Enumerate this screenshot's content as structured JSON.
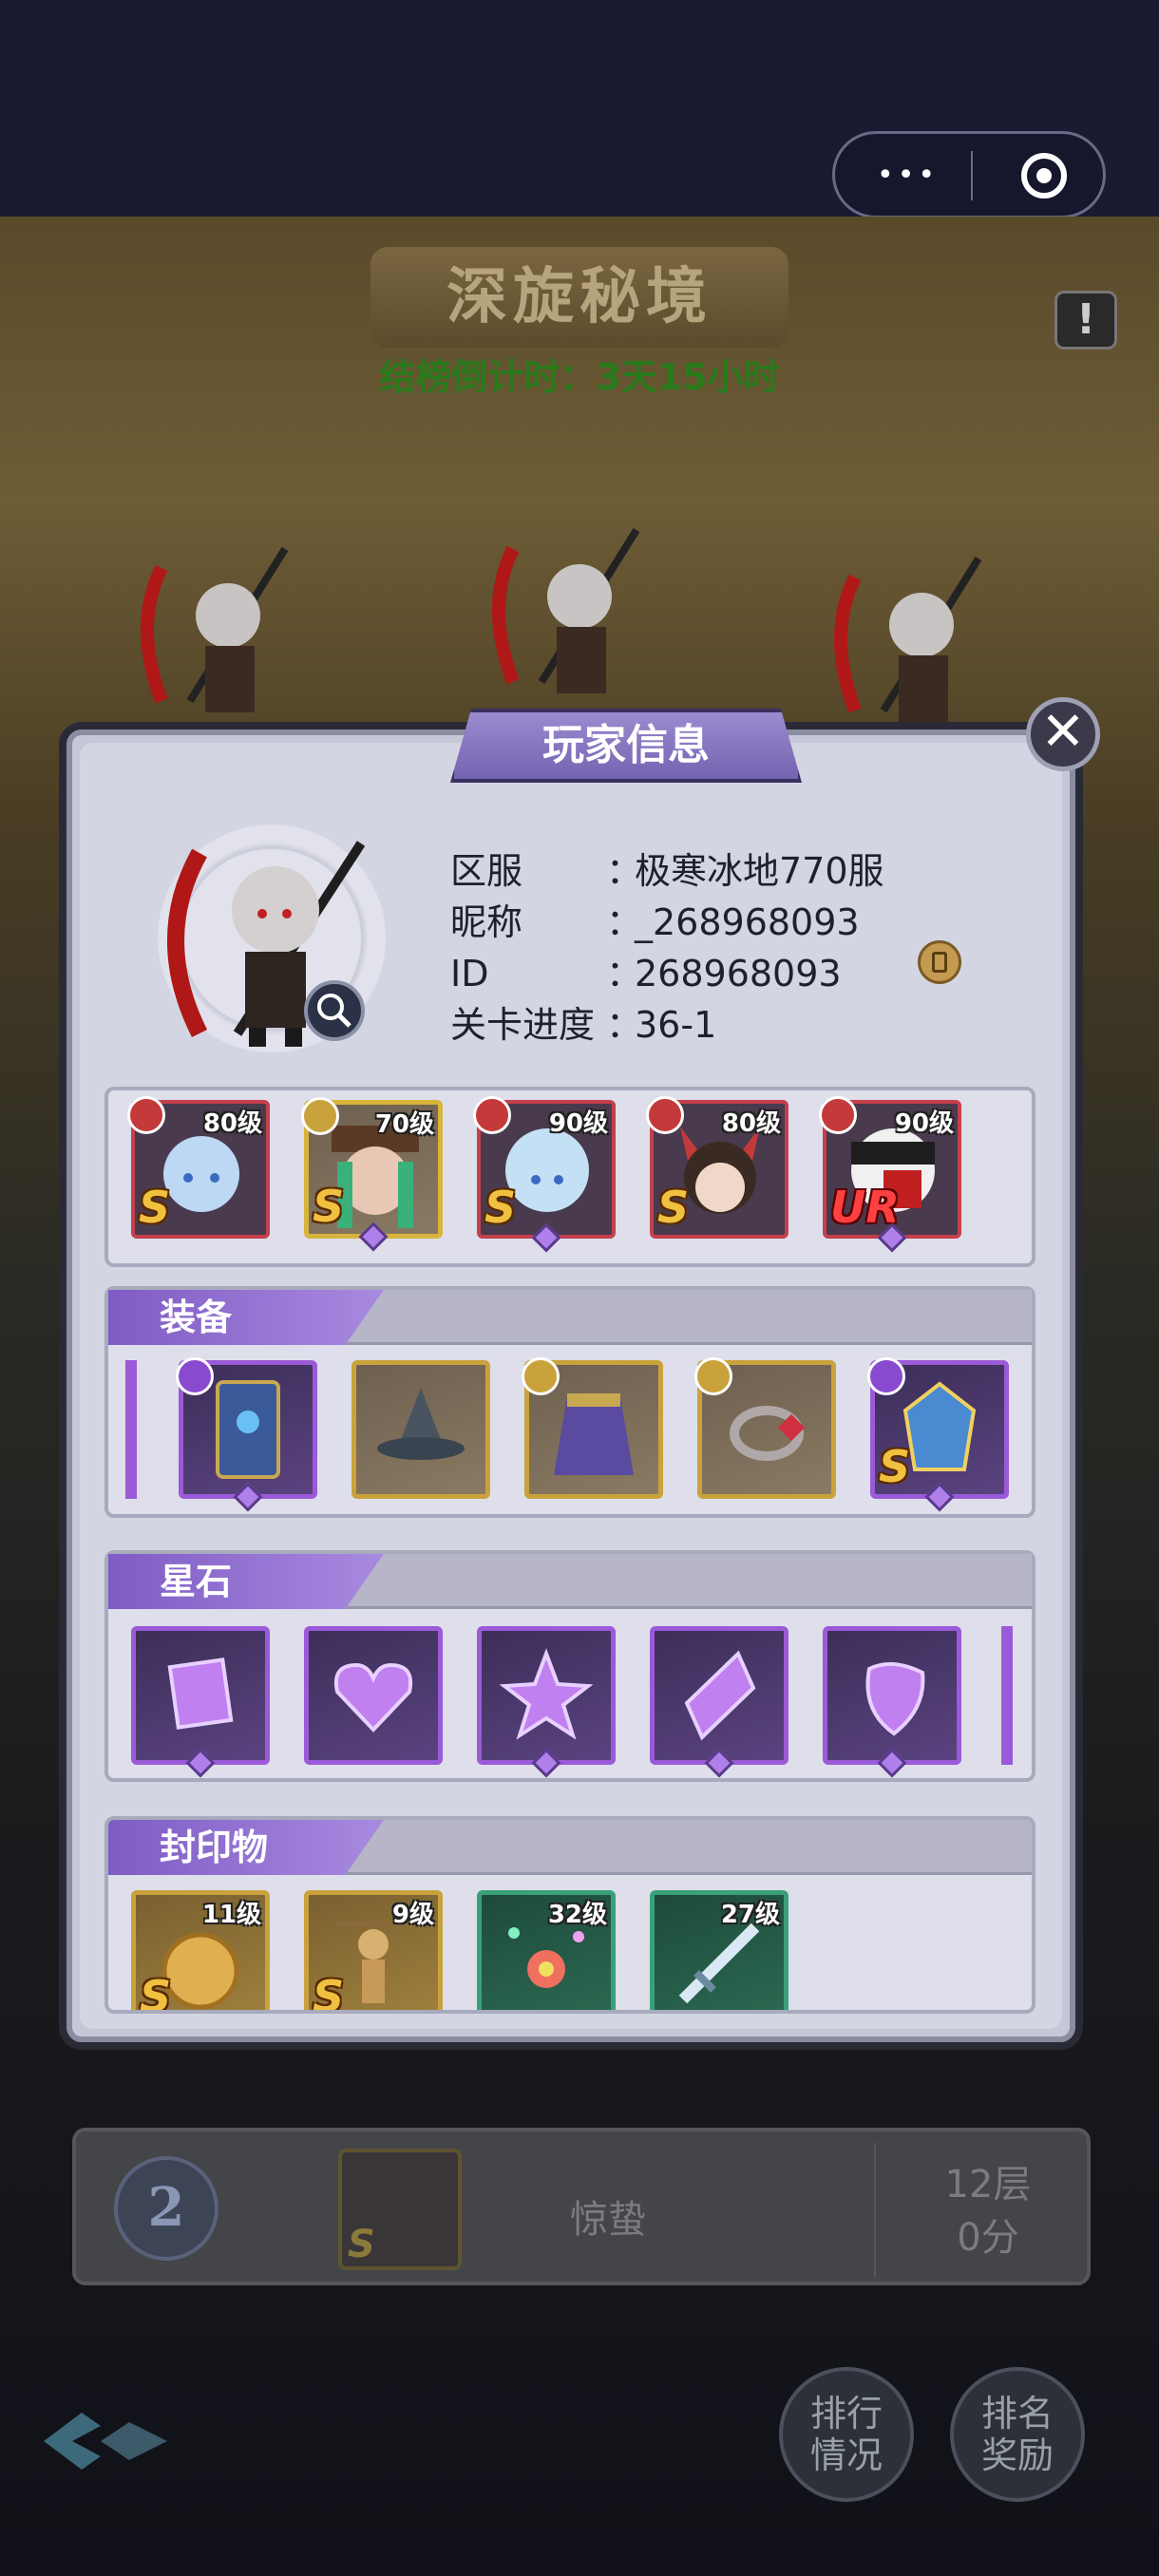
{
  "scene": {
    "title": "深旋秘境",
    "countdown": "结榜倒计时：3天15小时",
    "alert_glyph": "!"
  },
  "modal": {
    "title": "玩家信息",
    "close_glyph": "✕",
    "info": [
      {
        "label": "区服",
        "colon": "：",
        "value": "极寒冰地770服"
      },
      {
        "label": "昵称",
        "colon": "：",
        "value": "_268968093"
      },
      {
        "label": "ID",
        "colon": "：",
        "value": "268968093"
      },
      {
        "label": "关卡进度",
        "colon": "：",
        "value": "36-1"
      }
    ],
    "heroes": [
      {
        "level": "80级",
        "rank": "S",
        "frame": "red"
      },
      {
        "level": "70级",
        "rank": "S",
        "frame": "gold"
      },
      {
        "level": "90级",
        "rank": "S",
        "frame": "red"
      },
      {
        "level": "80级",
        "rank": "S",
        "frame": "red"
      },
      {
        "level": "90级",
        "rank": "UR",
        "frame": "red"
      }
    ],
    "equipment_title": "装备",
    "equipment": [
      {
        "name": "card-icon",
        "frame": "purple",
        "rank": ""
      },
      {
        "name": "hat-icon",
        "frame": "gold",
        "rank": ""
      },
      {
        "name": "cape-icon",
        "frame": "gold",
        "rank": ""
      },
      {
        "name": "ring-icon",
        "frame": "gold",
        "rank": ""
      },
      {
        "name": "armor-icon",
        "frame": "purple",
        "rank": "S"
      }
    ],
    "star_stone_title": "星石",
    "star_stones": [
      "square-gem-icon",
      "heart-gem-icon",
      "star-gem-icon",
      "diamond-gem-icon",
      "shield-gem-icon"
    ],
    "seal_title": "封印物",
    "seals": [
      {
        "level": "11级",
        "rank": "S",
        "frame": "gold"
      },
      {
        "level": "9级",
        "rank": "S",
        "frame": "gold"
      },
      {
        "level": "32级",
        "rank": "",
        "frame": "green"
      },
      {
        "level": "27级",
        "rank": "",
        "frame": "green"
      }
    ]
  },
  "rank_row": {
    "rank": "2",
    "avatar_rank": "S",
    "name": "惊蛰",
    "floor": "12层",
    "score": "0分"
  },
  "buttons": {
    "ranking": "排行情况",
    "ranking_line1": "排行",
    "ranking_line2": "情况",
    "rewards_line1": "排名",
    "rewards_line2": "奖励"
  }
}
